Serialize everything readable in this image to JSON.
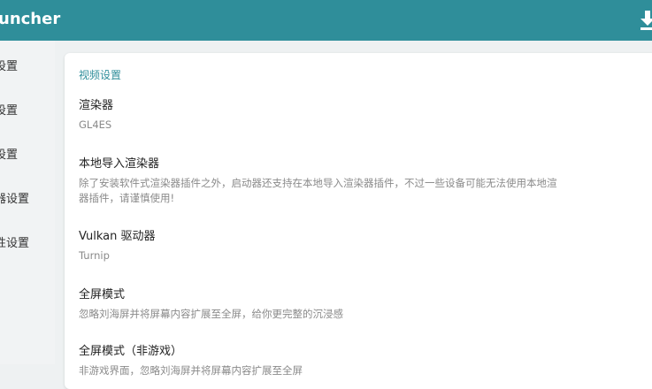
{
  "header": {
    "title": "uncher",
    "download_icon": "download-icon",
    "background": "#2f8e9a"
  },
  "sidebar": {
    "items": [
      {
        "label": "设置"
      },
      {
        "label": "设置"
      },
      {
        "label": "设置"
      },
      {
        "label": "器设置"
      },
      {
        "label": "性设置"
      }
    ]
  },
  "main": {
    "section_title": "视频设置",
    "settings": [
      {
        "title": "渲染器",
        "value": "GL4ES"
      },
      {
        "title": "本地导入渲染器",
        "desc_line1": "除了安装软件式渲染器插件之外，启动器还支持在本地导入渲染器插件，不过一些设备可能无法使用本地渲",
        "desc_line2": "器插件，请谨慎使用!"
      },
      {
        "title": "Vulkan 驱动器",
        "value": "Turnip"
      },
      {
        "title": "全屏模式",
        "value": "忽略刘海屏并将屏幕内容扩展至全屏，给你更完整的沉浸感"
      },
      {
        "title": "全屏模式（非游戏）",
        "value": "非游戏界面，忽略刘海屏并将屏幕内容扩展至全屏"
      }
    ]
  }
}
